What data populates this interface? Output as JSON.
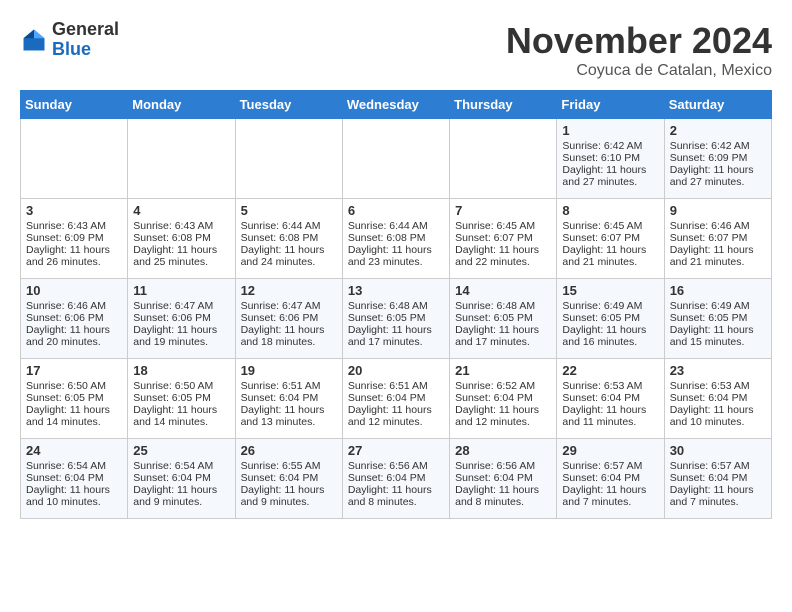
{
  "header": {
    "logo_general": "General",
    "logo_blue": "Blue",
    "month_title": "November 2024",
    "location": "Coyuca de Catalan, Mexico"
  },
  "days_of_week": [
    "Sunday",
    "Monday",
    "Tuesday",
    "Wednesday",
    "Thursday",
    "Friday",
    "Saturday"
  ],
  "weeks": [
    [
      {
        "day": "",
        "info": ""
      },
      {
        "day": "",
        "info": ""
      },
      {
        "day": "",
        "info": ""
      },
      {
        "day": "",
        "info": ""
      },
      {
        "day": "",
        "info": ""
      },
      {
        "day": "1",
        "info": "Sunrise: 6:42 AM\nSunset: 6:10 PM\nDaylight: 11 hours and 27 minutes."
      },
      {
        "day": "2",
        "info": "Sunrise: 6:42 AM\nSunset: 6:09 PM\nDaylight: 11 hours and 27 minutes."
      }
    ],
    [
      {
        "day": "3",
        "info": "Sunrise: 6:43 AM\nSunset: 6:09 PM\nDaylight: 11 hours and 26 minutes."
      },
      {
        "day": "4",
        "info": "Sunrise: 6:43 AM\nSunset: 6:08 PM\nDaylight: 11 hours and 25 minutes."
      },
      {
        "day": "5",
        "info": "Sunrise: 6:44 AM\nSunset: 6:08 PM\nDaylight: 11 hours and 24 minutes."
      },
      {
        "day": "6",
        "info": "Sunrise: 6:44 AM\nSunset: 6:08 PM\nDaylight: 11 hours and 23 minutes."
      },
      {
        "day": "7",
        "info": "Sunrise: 6:45 AM\nSunset: 6:07 PM\nDaylight: 11 hours and 22 minutes."
      },
      {
        "day": "8",
        "info": "Sunrise: 6:45 AM\nSunset: 6:07 PM\nDaylight: 11 hours and 21 minutes."
      },
      {
        "day": "9",
        "info": "Sunrise: 6:46 AM\nSunset: 6:07 PM\nDaylight: 11 hours and 21 minutes."
      }
    ],
    [
      {
        "day": "10",
        "info": "Sunrise: 6:46 AM\nSunset: 6:06 PM\nDaylight: 11 hours and 20 minutes."
      },
      {
        "day": "11",
        "info": "Sunrise: 6:47 AM\nSunset: 6:06 PM\nDaylight: 11 hours and 19 minutes."
      },
      {
        "day": "12",
        "info": "Sunrise: 6:47 AM\nSunset: 6:06 PM\nDaylight: 11 hours and 18 minutes."
      },
      {
        "day": "13",
        "info": "Sunrise: 6:48 AM\nSunset: 6:05 PM\nDaylight: 11 hours and 17 minutes."
      },
      {
        "day": "14",
        "info": "Sunrise: 6:48 AM\nSunset: 6:05 PM\nDaylight: 11 hours and 17 minutes."
      },
      {
        "day": "15",
        "info": "Sunrise: 6:49 AM\nSunset: 6:05 PM\nDaylight: 11 hours and 16 minutes."
      },
      {
        "day": "16",
        "info": "Sunrise: 6:49 AM\nSunset: 6:05 PM\nDaylight: 11 hours and 15 minutes."
      }
    ],
    [
      {
        "day": "17",
        "info": "Sunrise: 6:50 AM\nSunset: 6:05 PM\nDaylight: 11 hours and 14 minutes."
      },
      {
        "day": "18",
        "info": "Sunrise: 6:50 AM\nSunset: 6:05 PM\nDaylight: 11 hours and 14 minutes."
      },
      {
        "day": "19",
        "info": "Sunrise: 6:51 AM\nSunset: 6:04 PM\nDaylight: 11 hours and 13 minutes."
      },
      {
        "day": "20",
        "info": "Sunrise: 6:51 AM\nSunset: 6:04 PM\nDaylight: 11 hours and 12 minutes."
      },
      {
        "day": "21",
        "info": "Sunrise: 6:52 AM\nSunset: 6:04 PM\nDaylight: 11 hours and 12 minutes."
      },
      {
        "day": "22",
        "info": "Sunrise: 6:53 AM\nSunset: 6:04 PM\nDaylight: 11 hours and 11 minutes."
      },
      {
        "day": "23",
        "info": "Sunrise: 6:53 AM\nSunset: 6:04 PM\nDaylight: 11 hours and 10 minutes."
      }
    ],
    [
      {
        "day": "24",
        "info": "Sunrise: 6:54 AM\nSunset: 6:04 PM\nDaylight: 11 hours and 10 minutes."
      },
      {
        "day": "25",
        "info": "Sunrise: 6:54 AM\nSunset: 6:04 PM\nDaylight: 11 hours and 9 minutes."
      },
      {
        "day": "26",
        "info": "Sunrise: 6:55 AM\nSunset: 6:04 PM\nDaylight: 11 hours and 9 minutes."
      },
      {
        "day": "27",
        "info": "Sunrise: 6:56 AM\nSunset: 6:04 PM\nDaylight: 11 hours and 8 minutes."
      },
      {
        "day": "28",
        "info": "Sunrise: 6:56 AM\nSunset: 6:04 PM\nDaylight: 11 hours and 8 minutes."
      },
      {
        "day": "29",
        "info": "Sunrise: 6:57 AM\nSunset: 6:04 PM\nDaylight: 11 hours and 7 minutes."
      },
      {
        "day": "30",
        "info": "Sunrise: 6:57 AM\nSunset: 6:04 PM\nDaylight: 11 hours and 7 minutes."
      }
    ]
  ]
}
